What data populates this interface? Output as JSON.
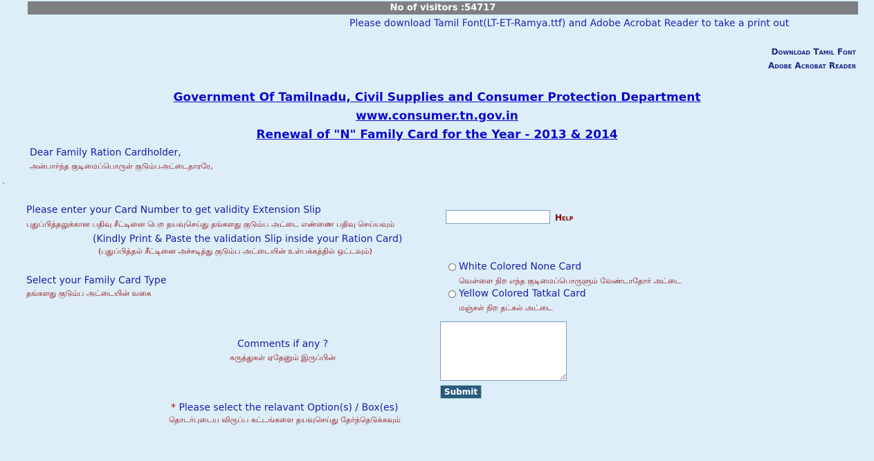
{
  "visitors": {
    "text": "No of visitors :54717"
  },
  "notice": {
    "text": "Please download Tamil Font(LT-ET-Ramya.ttf) and Adobe Acrobat Reader to take a print out"
  },
  "links": {
    "font": "Download Tamil Font",
    "acrobat": "Adobe Acrobat Reader"
  },
  "header": {
    "dept": "Government Of Tamilnadu, Civil Supplies and Consumer Protection Department",
    "site": "www.consumer.tn.gov.in",
    "renewal": "Renewal of \"N\" Family Card for the Year - 2013 & 2014"
  },
  "greeting": {
    "en": "Dear Family Ration Cardholder,",
    "ta": "அன்பார்ந்த குடிமைப்பொருள் குடும்பஅட்டைதாரரே,"
  },
  "tick": "`",
  "card_number": {
    "label_en": "Please enter your Card Number to get validity Extension Slip",
    "label_ta": "புதுப்பித்தலுக்கான பதிவு சீட்டினை பெற தயவுசெய்து தங்களது குடும்ப அட்டை எண்ணை பதிவு செய்யவும்",
    "value": "",
    "help": "Help",
    "note_en": "(Kindly Print & Paste the validation Slip inside your Ration Card)",
    "note_ta": "(புதுப்பித்தல் சீட்டினை அச்சடித்து குடும்ப அட்டையின் உள்பக்கத்தில் ஒட்டவும்)"
  },
  "card_type": {
    "label_en": "Select your Family Card Type",
    "label_ta": "தங்களது குடும்ப அட்டையின் வகை",
    "options": [
      {
        "en": "White Colored None Card",
        "ta": "வெள்ளை நிற எந்த குடிமைப்பொருளும் வேண்டாதோர் அட்டை"
      },
      {
        "en": "Yellow Colored Tatkal Card",
        "ta": "மஞ்சள் நிற தட்கல் அட்டை"
      }
    ]
  },
  "comments": {
    "label_en": "Comments if any ?",
    "label_ta": "கருத்துகள் ஏதேனும் இருப்பின்",
    "value": ""
  },
  "submit": {
    "label": "Submit"
  },
  "footer": {
    "star": "*",
    "en": "Please select the relavant Option(s) / Box(es)",
    "ta": "தொடர்புடைய விருப்ப கட்டங்களை தயவுசெய்து தேர்ந்தெடுக்கவும்"
  }
}
